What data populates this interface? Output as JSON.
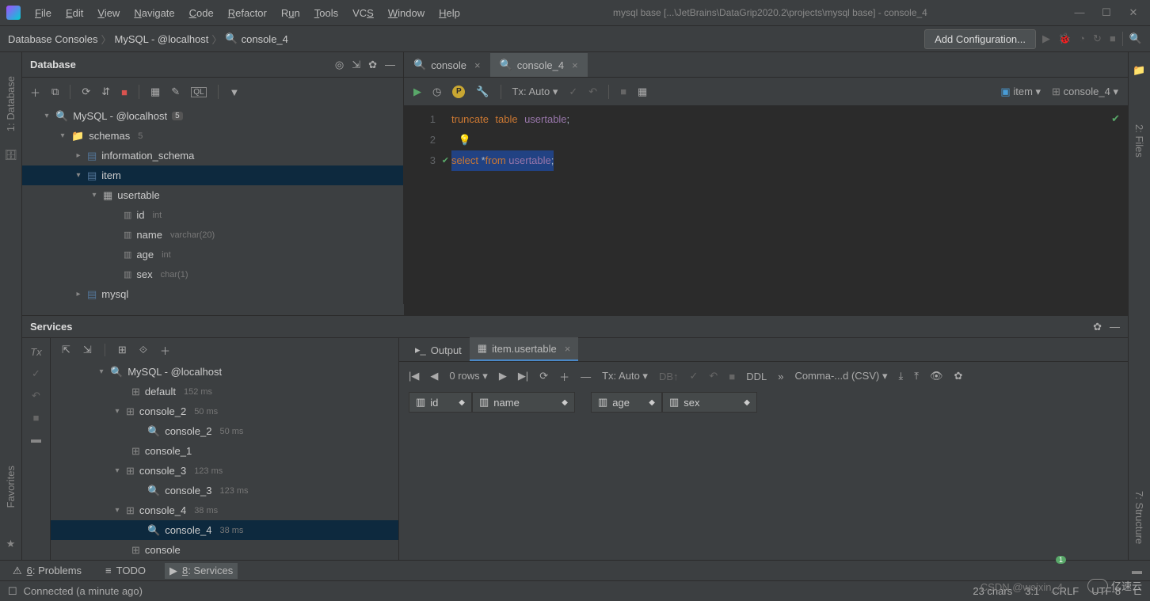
{
  "menu": [
    "File",
    "Edit",
    "View",
    "Navigate",
    "Code",
    "Refactor",
    "Run",
    "Tools",
    "VCS",
    "Window",
    "Help"
  ],
  "title_path": "mysql base [...\\JetBrains\\DataGrip2020.2\\projects\\mysql base] - console_4",
  "breadcrumbs": {
    "b1": "Database Consoles",
    "b2": "MySQL - @localhost",
    "b3": "console_4"
  },
  "add_config": "Add Configuration...",
  "db_panel": {
    "title": "Database"
  },
  "tree": {
    "ds": "MySQL - @localhost",
    "ds_badge": "5",
    "schemas": "schemas",
    "schemas_n": "5",
    "info": "information_schema",
    "item": "item",
    "table": "usertable",
    "cols": [
      {
        "name": "id",
        "type": "int"
      },
      {
        "name": "name",
        "type": "varchar(20)"
      },
      {
        "name": "age",
        "type": "int"
      },
      {
        "name": "sex",
        "type": "char(1)"
      }
    ],
    "mysql": "mysql"
  },
  "tabs": [
    {
      "label": "console",
      "active": false
    },
    {
      "label": "console_4",
      "active": true
    }
  ],
  "ed_tx": "Tx: Auto",
  "ed_target_item": "item",
  "ed_target_console": "console_4",
  "code": {
    "l1": {
      "kw1": "truncate",
      "kw2": "table",
      "id": "usertable",
      "semi": ";"
    },
    "l3": {
      "kw1": "select",
      "star": "*",
      "kw2": "from",
      "id": "usertable",
      "semi": ";"
    }
  },
  "services": {
    "title": "Services"
  },
  "svc_tree": {
    "ds": "MySQL - @localhost",
    "default": "default",
    "default_ms": "152 ms",
    "c2": "console_2",
    "c2_ms": "50 ms",
    "c2a": "console_2",
    "c2a_ms": "50 ms",
    "c1": "console_1",
    "c3": "console_3",
    "c3_ms": "123 ms",
    "c3a": "console_3",
    "c3a_ms": "123 ms",
    "c4": "console_4",
    "c4_ms": "38 ms",
    "c4a": "console_4",
    "c4a_ms": "38 ms",
    "cons": "console"
  },
  "output_tab": "Output",
  "result_tab": "item.usertable",
  "rows_label": "0 rows",
  "res_tx": "Tx: Auto",
  "ddl": "DDL",
  "csv": "Comma-...d (CSV)",
  "cols_head": [
    "id",
    "name",
    "age",
    "sex"
  ],
  "bottom": {
    "problems": "6: Problems",
    "todo": "TODO",
    "services": "8: Services"
  },
  "green_badge": "1",
  "status": {
    "conn": "Connected (a minute ago)",
    "chars": "23 chars",
    "pos": "3:1",
    "crlf": "CRLF",
    "enc": "UTF-8"
  },
  "watermark": "CSDN @weixin_4",
  "wm2": "亿速云",
  "left_gutter": {
    "db": "1: Database"
  },
  "right_gutter": {
    "files": "2: Files",
    "struct": "7: Structure"
  },
  "favorites": "Favorites"
}
